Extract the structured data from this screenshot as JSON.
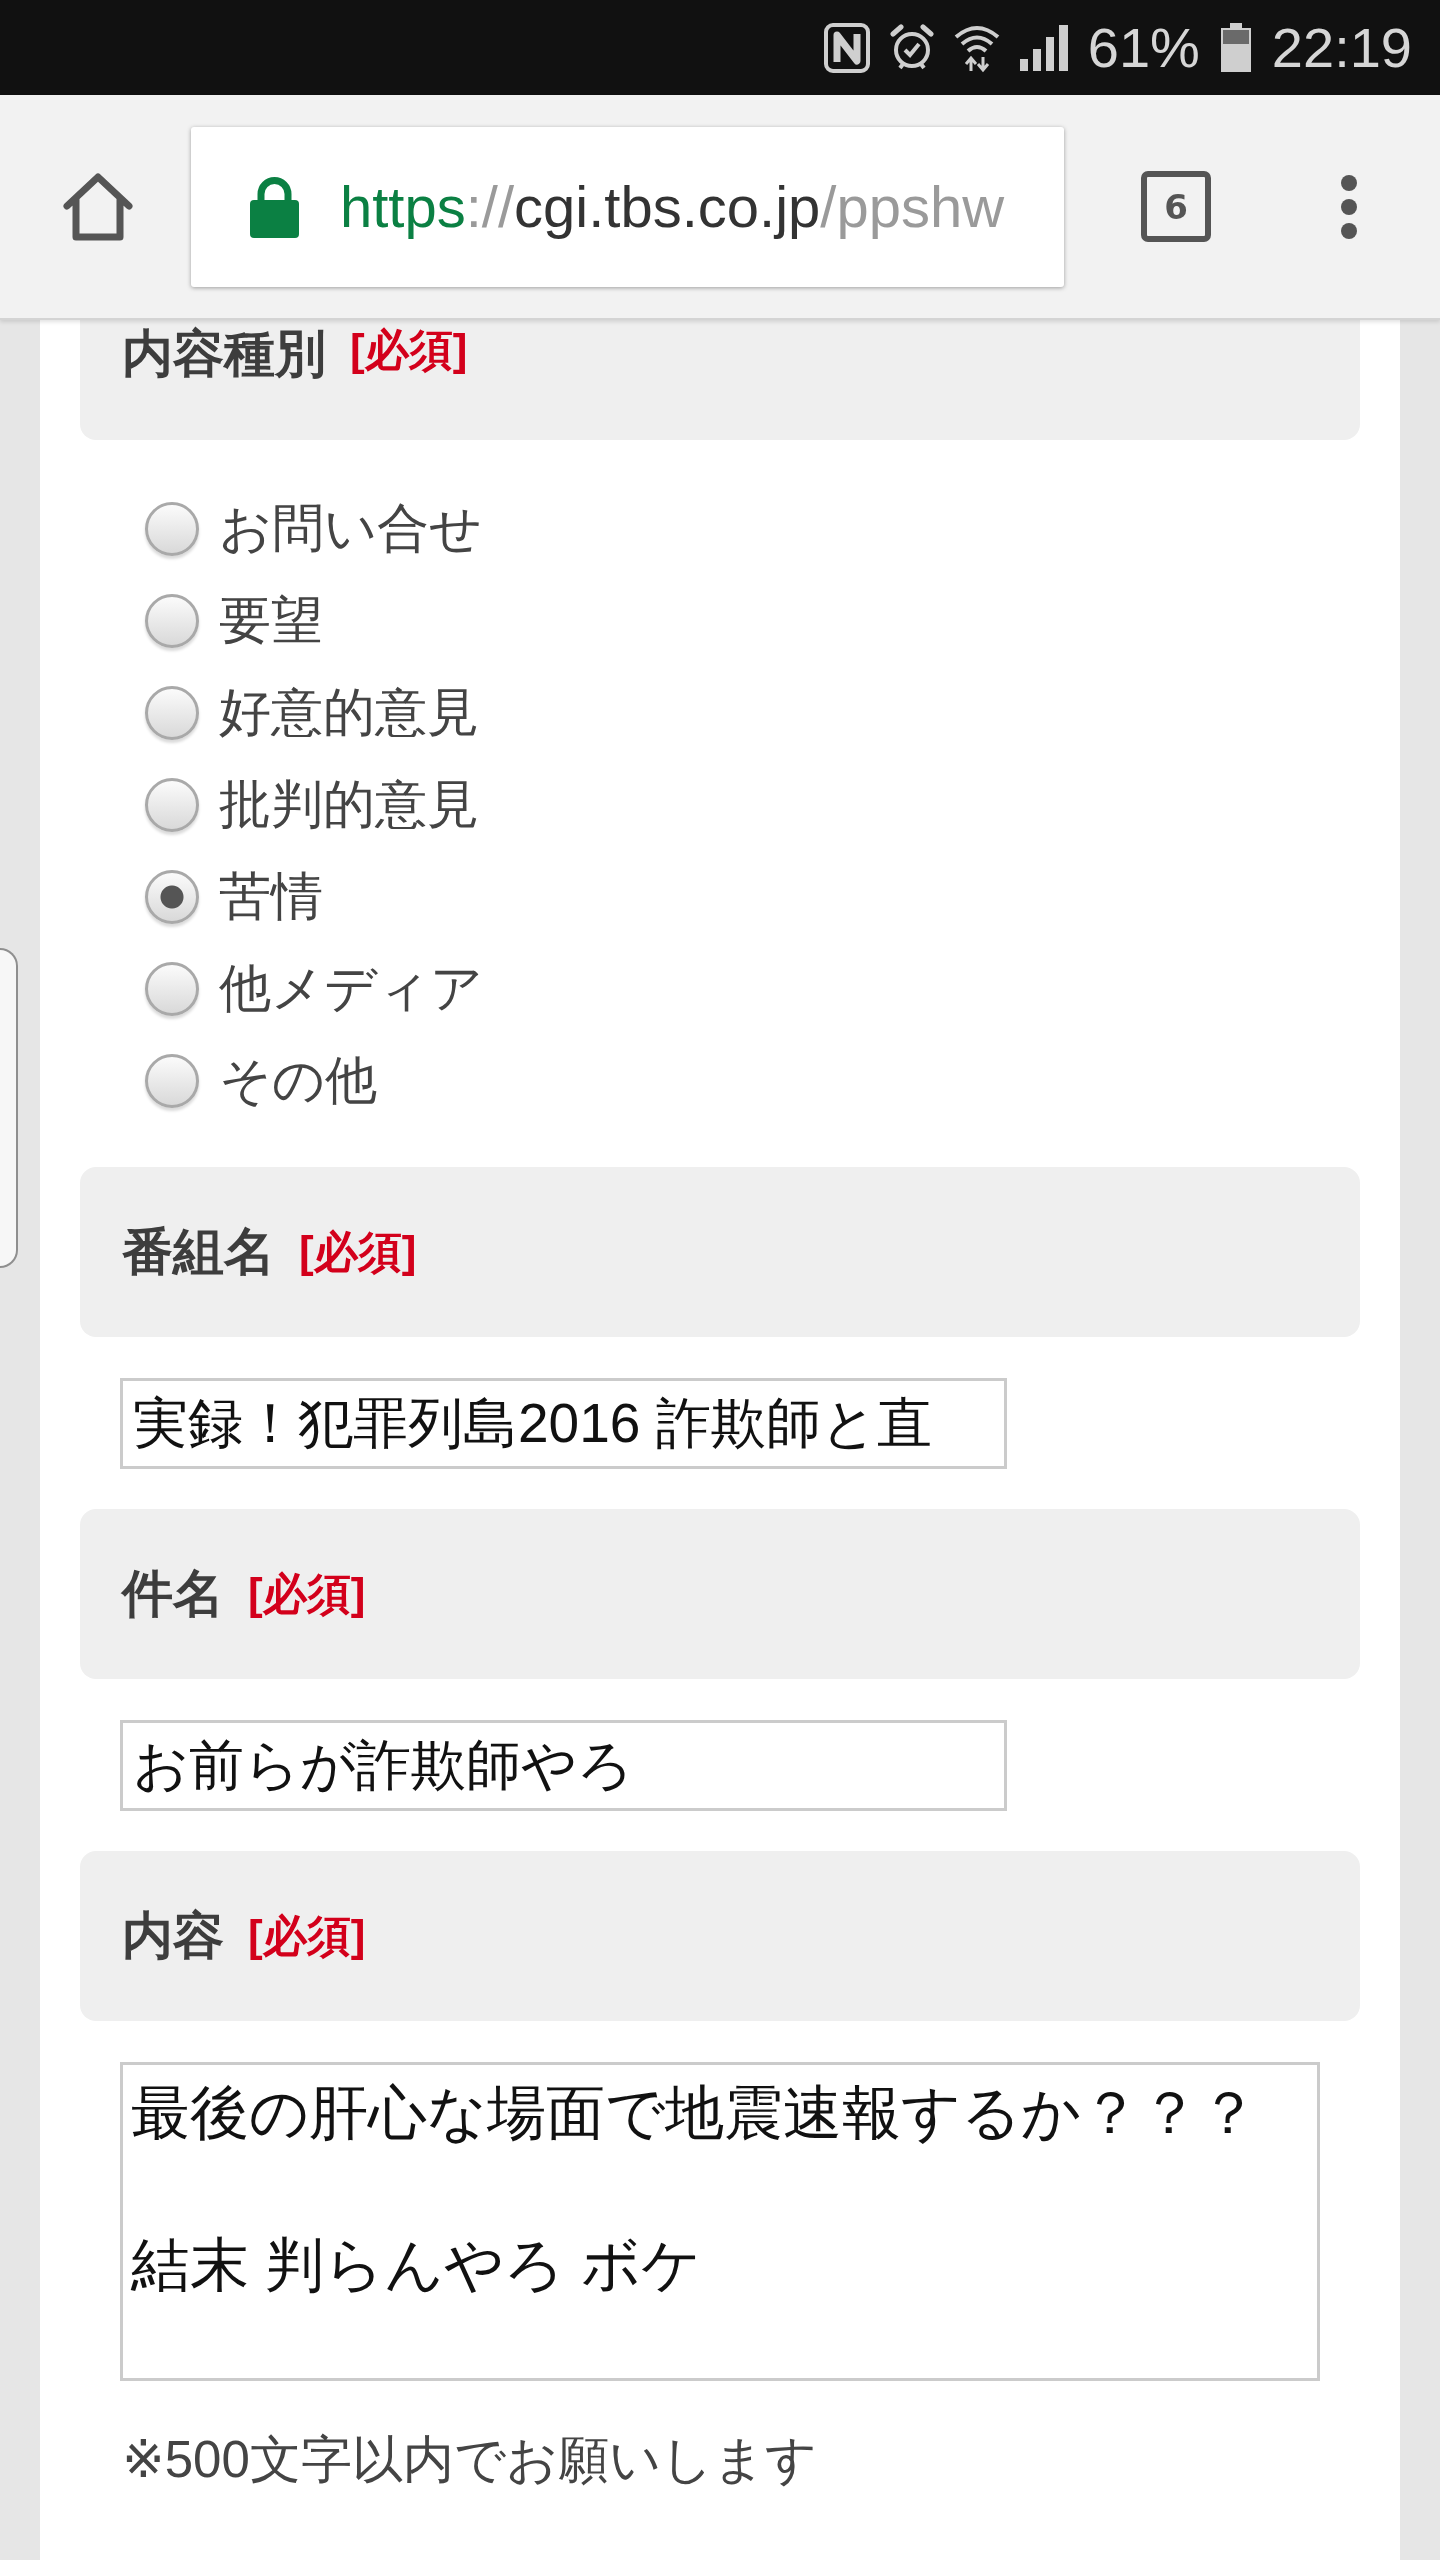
{
  "status_bar": {
    "battery": "61%",
    "time": "22:19"
  },
  "browser": {
    "url": {
      "scheme": "https",
      "separator": "://",
      "host": "cgi.tbs.co.jp",
      "path": "/ppshw"
    },
    "tab_count": "6"
  },
  "form": {
    "sections": [
      {
        "kind": "radio",
        "label": "内容種別",
        "required": "[必須]",
        "options": [
          {
            "label": "お問い合せ",
            "selected": false
          },
          {
            "label": "要望",
            "selected": false
          },
          {
            "label": "好意的意見",
            "selected": false
          },
          {
            "label": "批判的意見",
            "selected": false
          },
          {
            "label": "苦情",
            "selected": true
          },
          {
            "label": "他メディア",
            "selected": false
          },
          {
            "label": "その他",
            "selected": false
          }
        ]
      },
      {
        "kind": "text",
        "label": "番組名",
        "required": "[必須]",
        "value": "実録！犯罪列島2016 詐欺師と直"
      },
      {
        "kind": "text",
        "label": "件名",
        "required": "[必須]",
        "value": "お前らが詐欺師やろ"
      },
      {
        "kind": "textarea",
        "label": "内容",
        "required": "[必須]",
        "paragraphs": [
          "最後の肝心な場面で地震速報するか？？？",
          "結末 判らんやろ ボケ"
        ],
        "note": "※500文字以内でお願いします"
      }
    ]
  }
}
